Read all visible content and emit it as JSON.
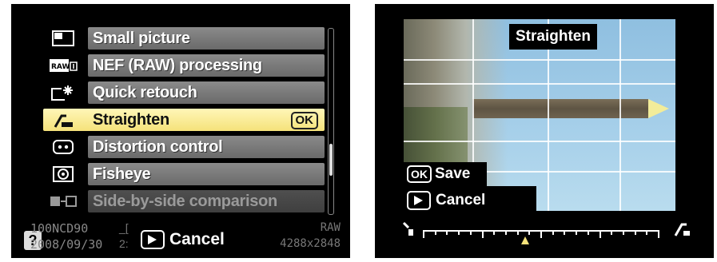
{
  "retouch_menu": {
    "items": [
      {
        "icon": "small-picture-icon",
        "label": "Small picture",
        "state": "normal"
      },
      {
        "icon": "raw-processing-icon",
        "label": "NEF (RAW) processing",
        "state": "normal"
      },
      {
        "icon": "quick-retouch-icon",
        "label": "Quick retouch",
        "state": "normal"
      },
      {
        "icon": "straighten-icon",
        "label": "Straighten",
        "state": "selected",
        "badge": "OK"
      },
      {
        "icon": "distortion-icon",
        "label": "Distortion control",
        "state": "normal"
      },
      {
        "icon": "fisheye-icon",
        "label": "Fisheye",
        "state": "normal"
      },
      {
        "icon": "side-by-side-icon",
        "label": "Side-by-side comparison",
        "state": "disabled"
      }
    ],
    "status": {
      "help": "?",
      "folder_file": "100NCD90",
      "date_time": "2008/09/30",
      "frag_top": "_[",
      "frag_bottom": "2:",
      "cancel_label": "Cancel",
      "quality": "RAW",
      "image_size": "4288x2848"
    }
  },
  "straighten_editor": {
    "title": "Straighten",
    "save_badge": "OK",
    "save_label": "Save",
    "cancel_label": "Cancel",
    "rotation_value": 0
  },
  "colors": {
    "selection": "#f5e27a",
    "menu_bar": "#7a7a7a",
    "background": "#000000"
  }
}
